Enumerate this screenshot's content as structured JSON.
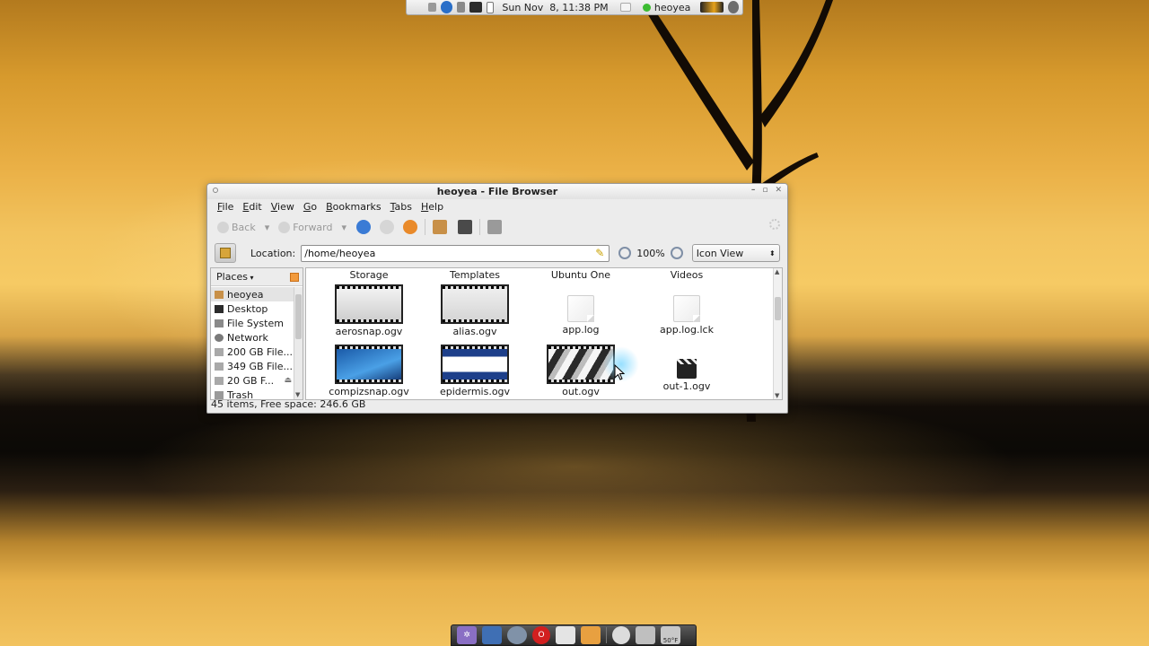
{
  "top_panel": {
    "clock": "Sun Nov  8, 11:38 PM",
    "user": "heoyea",
    "icons": [
      "window-icon",
      "hp-logo-icon",
      "speaker-icon",
      "monitor-icon",
      "clipboard-icon",
      "mail-icon",
      "status-online-icon",
      "battery-icon",
      "power-icon"
    ]
  },
  "window": {
    "title": "heoyea - File Browser",
    "menu": [
      {
        "pre": "",
        "ul": "F",
        "post": "ile"
      },
      {
        "pre": "",
        "ul": "E",
        "post": "dit"
      },
      {
        "pre": "",
        "ul": "V",
        "post": "iew"
      },
      {
        "pre": "",
        "ul": "G",
        "post": "o"
      },
      {
        "pre": "",
        "ul": "B",
        "post": "ookmarks"
      },
      {
        "pre": "",
        "ul": "T",
        "post": "abs"
      },
      {
        "pre": "",
        "ul": "H",
        "post": "elp"
      }
    ],
    "toolbar": {
      "back": "Back",
      "forward": "Forward",
      "icons": [
        "go-up-icon",
        "stop-icon",
        "reload-icon",
        "home-icon",
        "computer-icon",
        "find-icon"
      ]
    },
    "location": {
      "label": "Location:",
      "value": "/home/heoyea",
      "zoom": "100%",
      "view": "Icon View"
    },
    "sidebar": {
      "header": "Places",
      "items": [
        {
          "label": "heoyea",
          "icon": "home-icon",
          "selected": true
        },
        {
          "label": "Desktop",
          "icon": "desktop-icon",
          "selected": false
        },
        {
          "label": "File System",
          "icon": "harddisk-icon",
          "selected": false
        },
        {
          "label": "Network",
          "icon": "network-icon",
          "selected": false
        },
        {
          "label": "200 GB File...",
          "icon": "drive-icon",
          "selected": false
        },
        {
          "label": "349 GB File...",
          "icon": "drive-icon",
          "selected": false
        },
        {
          "label": "20 GB F...",
          "icon": "drive-icon",
          "selected": false
        },
        {
          "label": "Trash",
          "icon": "trash-icon",
          "selected": false
        }
      ]
    },
    "folders_row": [
      "Storage",
      "Templates",
      "Ubuntu One",
      "Videos"
    ],
    "files": [
      {
        "name": "aerosnap.ogv",
        "kind": "video-thumb"
      },
      {
        "name": "alias.ogv",
        "kind": "video-thumb"
      },
      {
        "name": "app.log",
        "kind": "document"
      },
      {
        "name": "app.log.lck",
        "kind": "document"
      },
      {
        "name": "compizsnap.ogv",
        "kind": "video-thumb"
      },
      {
        "name": "epidermis.ogv",
        "kind": "video-thumb"
      },
      {
        "name": "out.ogv",
        "kind": "video-thumb"
      },
      {
        "name": "out-1.ogv",
        "kind": "video-icon"
      }
    ],
    "status": "45 items, Free space: 246.6 GB"
  },
  "dock": {
    "icons": [
      "settings-icon",
      "terminal-icon",
      "web-browser-icon",
      "opera-icon",
      "folder-icon",
      "package-icon",
      "clock-icon",
      "drive-icon",
      "weather-icon"
    ],
    "weather_temp": "50°F"
  }
}
